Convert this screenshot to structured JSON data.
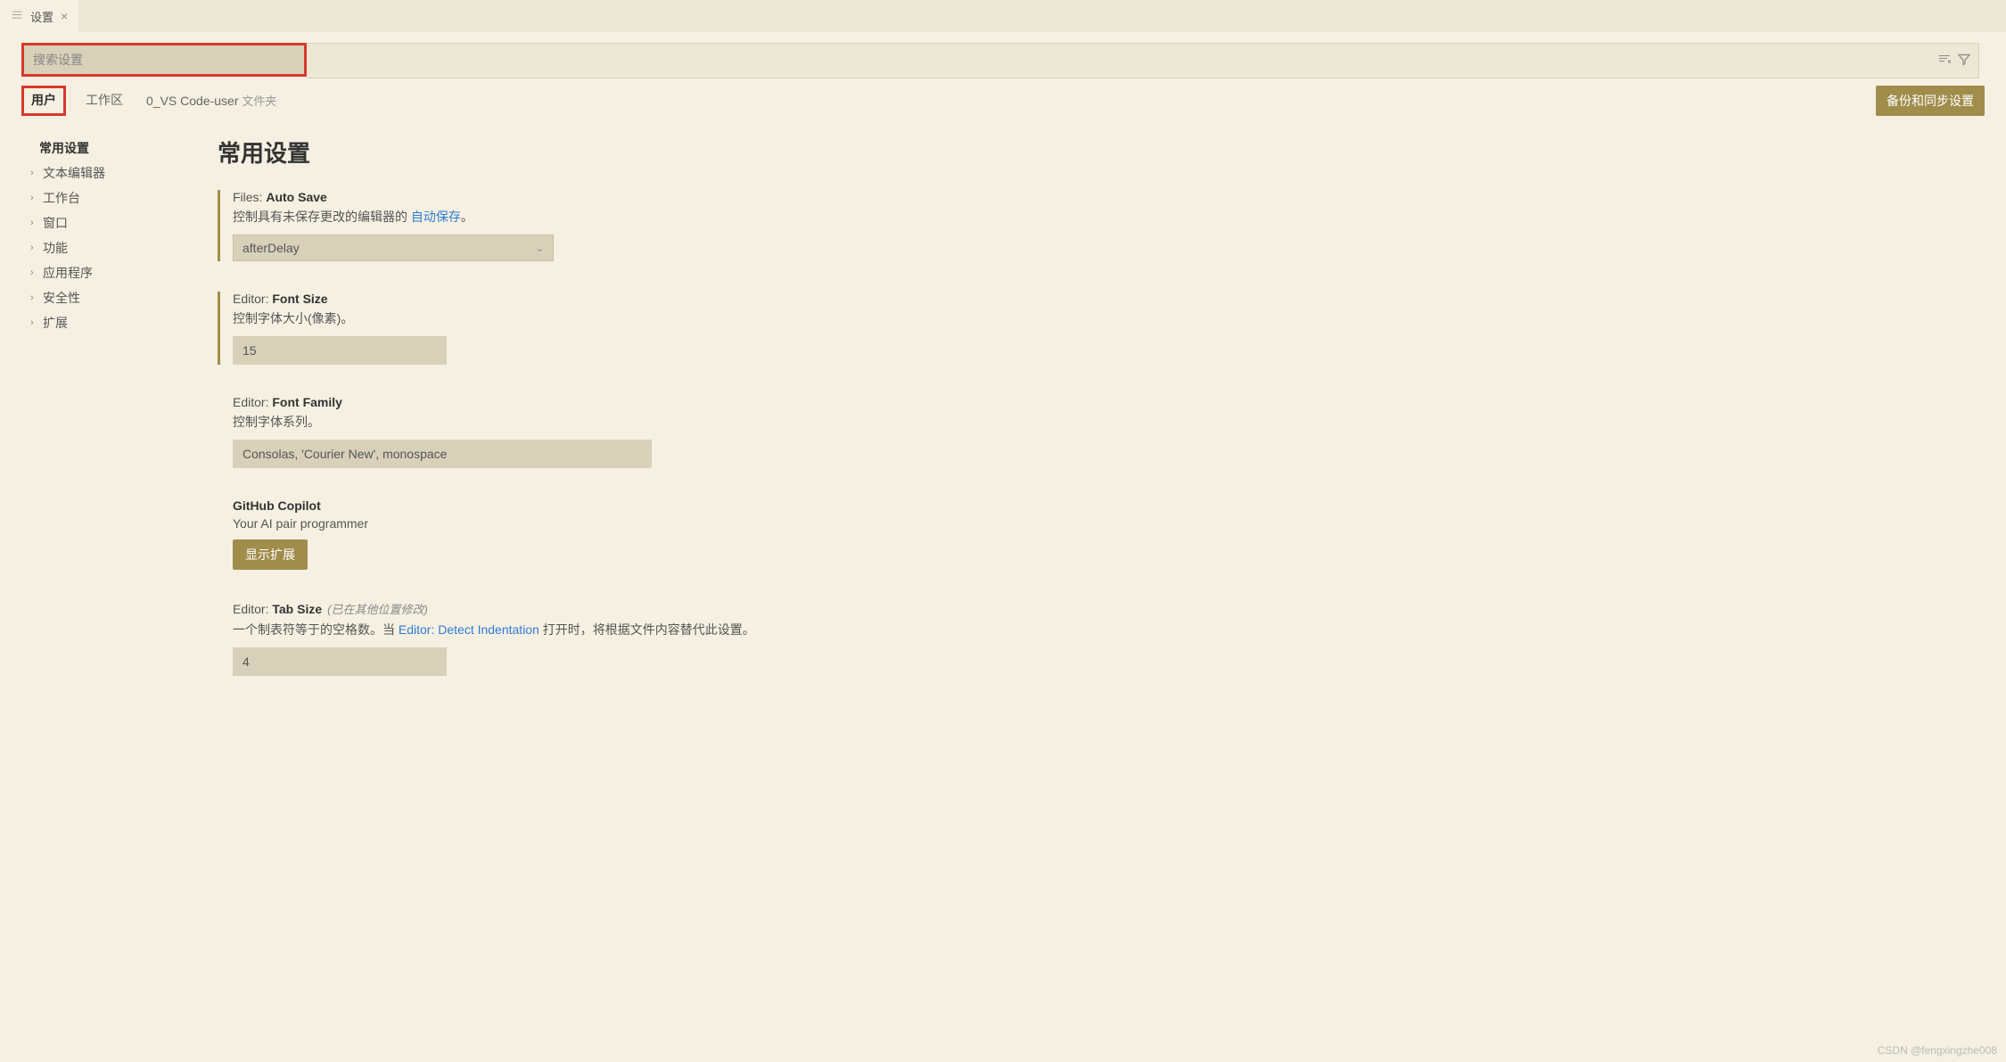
{
  "tab": {
    "title": "设置"
  },
  "search": {
    "placeholder": "搜索设置"
  },
  "scopes": {
    "user": "用户",
    "workspace": "工作区",
    "folder": "0_VS Code-user",
    "folder_suffix": "文件夹"
  },
  "sync_button": "备份和同步设置",
  "sidebar": {
    "items": [
      {
        "label": "常用设置",
        "active": true
      },
      {
        "label": "文本编辑器"
      },
      {
        "label": "工作台"
      },
      {
        "label": "窗口"
      },
      {
        "label": "功能"
      },
      {
        "label": "应用程序"
      },
      {
        "label": "安全性"
      },
      {
        "label": "扩展"
      }
    ]
  },
  "main": {
    "title": "常用设置",
    "settings": [
      {
        "modified": true,
        "label_prefix": "Files: ",
        "label_bold": "Auto Save",
        "desc_pre": "控制具有未保存更改的编辑器的 ",
        "desc_link": "自动保存",
        "desc_post": "。",
        "control": "select",
        "value": "afterDelay"
      },
      {
        "modified": true,
        "label_prefix": "Editor: ",
        "label_bold": "Font Size",
        "desc": "控制字体大小(像素)。",
        "control": "text",
        "value": "15"
      },
      {
        "label_prefix": "Editor: ",
        "label_bold": "Font Family",
        "desc": "控制字体系列。",
        "control": "text_wide",
        "value": "Consolas, 'Courier New', monospace"
      },
      {
        "label_bold": "GitHub Copilot",
        "desc": "Your AI pair programmer",
        "control": "button",
        "button_label": "显示扩展"
      },
      {
        "label_prefix": "Editor: ",
        "label_bold": "Tab Size",
        "note": "(已在其他位置修改)",
        "desc_pre": "一个制表符等于的空格数。当 ",
        "desc_link": "Editor: Detect Indentation",
        "desc_post": " 打开时，将根据文件内容替代此设置。",
        "control": "text",
        "value": "4"
      }
    ]
  },
  "watermark": "CSDN @fengxingzhe008"
}
